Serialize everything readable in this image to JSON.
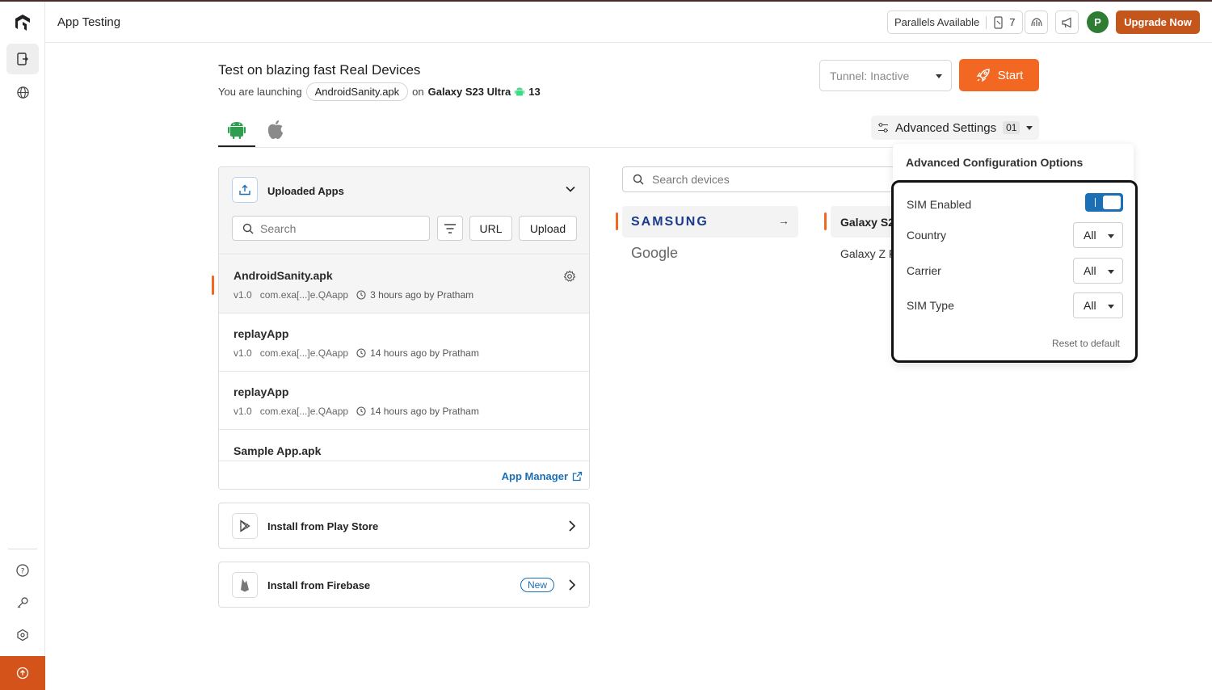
{
  "header": {
    "title": "App Testing",
    "parallels_label": "Parallels Available",
    "parallels_count": "7",
    "avatar_initial": "P",
    "upgrade_label": "Upgrade Now"
  },
  "launch": {
    "title": "Test on blazing fast Real Devices",
    "prefix": "You are launching",
    "app": "AndroidSanity.apk",
    "on": "on",
    "device": "Galaxy S23 Ultra",
    "os_version": "13"
  },
  "tunnel": {
    "label": "Tunnel: Inactive"
  },
  "start": {
    "label": "Start"
  },
  "advanced": {
    "label": "Advanced Settings",
    "badge": "01"
  },
  "apps": {
    "title": "Uploaded Apps",
    "search_placeholder": "Search",
    "url_label": "URL",
    "upload_label": "Upload",
    "items": [
      {
        "name": "AndroidSanity.apk",
        "version": "v1.0",
        "package": "com.exa[...]e.QAapp",
        "time": "3 hours ago by Pratham"
      },
      {
        "name": "replayApp",
        "version": "v1.0",
        "package": "com.exa[...]e.QAapp",
        "time": "14 hours ago by Pratham"
      },
      {
        "name": "replayApp",
        "version": "v1.0",
        "package": "com.exa[...]e.QAapp",
        "time": "14 hours ago by Pratham"
      },
      {
        "name": "Sample App.apk"
      }
    ],
    "manager_label": "App Manager"
  },
  "install": {
    "play_store": "Install from Play Store",
    "firebase": "Install from Firebase",
    "new_badge": "New"
  },
  "devices": {
    "search_placeholder": "Search devices",
    "brands": [
      "SAMSUNG",
      "Google"
    ],
    "models": [
      "Galaxy S2",
      "Galaxy Z F"
    ]
  },
  "adv_pop": {
    "title": "Advanced Configuration Options",
    "sim_enabled": "SIM Enabled",
    "country": "Country",
    "country_value": "All",
    "carrier": "Carrier",
    "carrier_value": "All",
    "sim_type": "SIM Type",
    "sim_type_value": "All",
    "reset": "Reset to default"
  },
  "colors": {
    "accent": "#f26722",
    "brand": "#c4561c",
    "link": "#1a6fb5"
  }
}
